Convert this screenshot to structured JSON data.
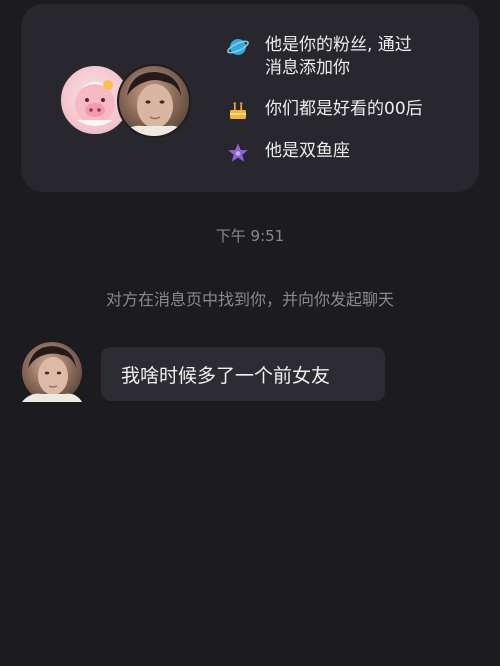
{
  "profile_card": {
    "rows": [
      {
        "icon": "planet-icon",
        "text": "他是你的粉丝, 通过\n消息添加你"
      },
      {
        "icon": "cake-icon",
        "text": "你们都是好看的00后"
      },
      {
        "icon": "star-icon",
        "text": "他是双鱼座"
      }
    ]
  },
  "chat": {
    "timestamp": "下午 9:51",
    "system_message": "对方在消息页中找到你，并向你发起聊天",
    "messages": [
      {
        "text": "我啥时候多了一个前女友"
      }
    ]
  },
  "colors": {
    "background": "#1c1b20",
    "card": "#28272d",
    "bubble": "#2d2c32",
    "planet": "#37a7d8",
    "cake": "#f5b53a",
    "star": "#8e63d8"
  }
}
